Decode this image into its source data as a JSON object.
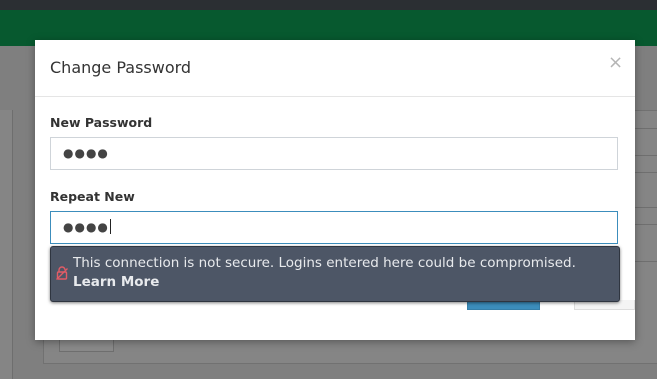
{
  "modal": {
    "title": "Change Password",
    "close": "×",
    "new_password": {
      "label": "New Password",
      "value": "●●●●"
    },
    "repeat_new": {
      "label": "Repeat New",
      "value": "●●●●"
    }
  },
  "insecure_popup": {
    "message": "This connection is not secure. Logins entered here could be compromised.",
    "link": "Learn More"
  },
  "colors": {
    "header_green": "#07592f",
    "primary_blue": "#3c8dbc",
    "popup_bg": "#4d5666",
    "lock_red": "#e25c66"
  },
  "icons": {
    "popup_lock": "insecure-lock-icon"
  }
}
